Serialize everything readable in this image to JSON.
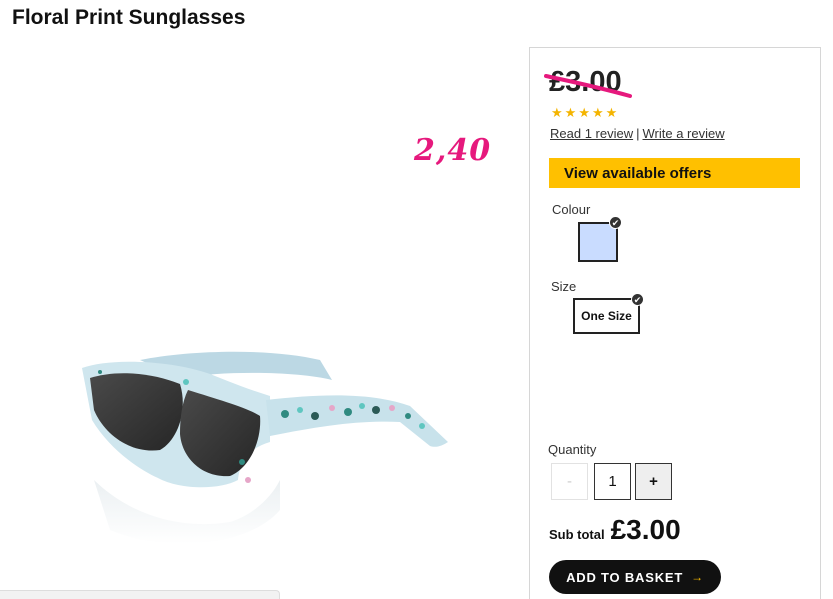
{
  "product": {
    "title": "Floral Print Sunglasses",
    "handwritten_price": "2,40",
    "image_name": "floral-print-sunglasses"
  },
  "pricing": {
    "old_price": "£3.00",
    "strike_color": "#e6197d"
  },
  "reviews": {
    "rating": 5,
    "rating_max": 5,
    "read_link": "Read 1 review",
    "separator": "|",
    "write_link": "Write a review"
  },
  "offers": {
    "label": "View available offers",
    "color": "#ffc000"
  },
  "options": {
    "colour_label": "Colour",
    "colour_swatch": "#c9dcff",
    "size_label": "Size",
    "size_value": "One Size",
    "selected_icon": "check-icon"
  },
  "quantity": {
    "label": "Quantity",
    "minus": "-",
    "value": "1",
    "plus": "+"
  },
  "subtotal": {
    "label": "Sub total",
    "value": "£3.00"
  },
  "basket": {
    "label": "ADD TO BASKET",
    "icon": "arrow-right-icon",
    "arrow": "→"
  }
}
